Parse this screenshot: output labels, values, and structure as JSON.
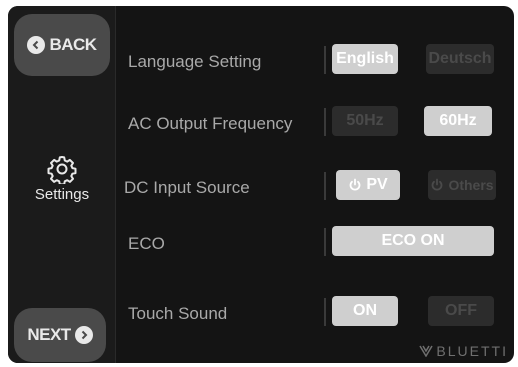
{
  "nav": {
    "back_label": "BACK",
    "next_label": "NEXT",
    "section_label": "Settings"
  },
  "rows": [
    {
      "label": "Language Setting",
      "options": [
        "English",
        "Deutsch"
      ],
      "selected": "English"
    },
    {
      "label": "AC Output Frequency",
      "options": [
        "50Hz",
        "60Hz"
      ],
      "selected": "60Hz"
    },
    {
      "label": "DC Input Source",
      "options": [
        "PV",
        "Others"
      ],
      "selected": "PV"
    },
    {
      "label": "ECO",
      "options": [
        "ECO ON"
      ],
      "selected": "ECO ON"
    },
    {
      "label": "Touch Sound",
      "options": [
        "ON",
        "OFF"
      ],
      "selected": "ON"
    }
  ],
  "brand": {
    "name": "BLUETTI"
  },
  "icons": {
    "back": "arrow-left-circle-icon",
    "next": "arrow-right-circle-icon",
    "settings": "gear-icon",
    "power": "power-icon",
    "brand": "bluetti-logo-icon"
  },
  "colors": {
    "background": "#141414",
    "rail": "#1b1b1b",
    "button": "#4a4a4a",
    "selected": "#cfcfcf",
    "unselected": "#2c2c2c"
  }
}
